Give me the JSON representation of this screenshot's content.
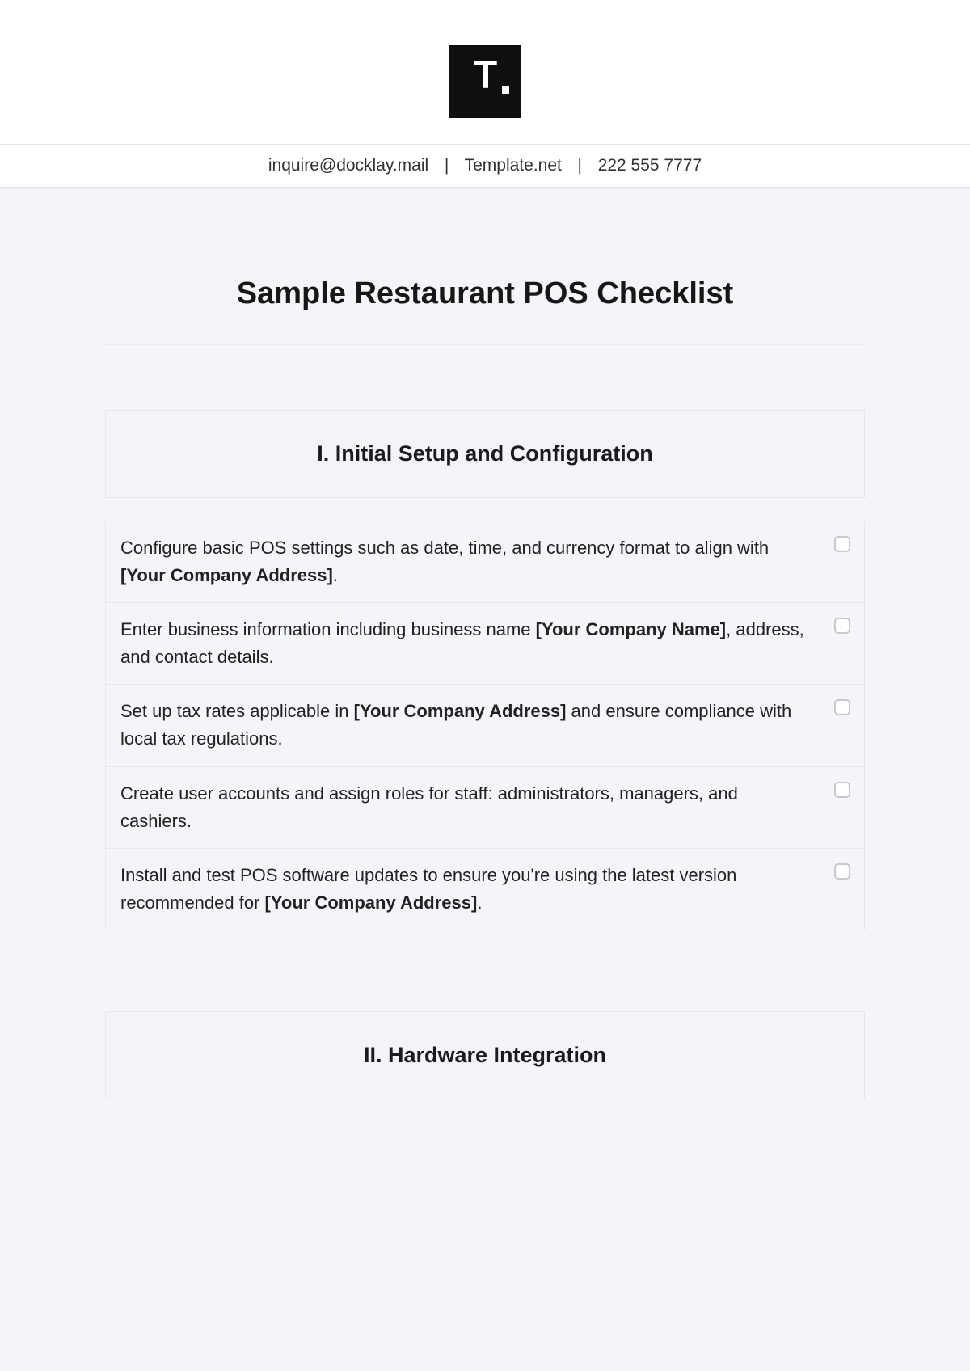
{
  "header": {
    "logo_text": "T",
    "contact": {
      "email": "inquire@docklay.mail",
      "site": "Template.net",
      "phone": "222 555 7777"
    }
  },
  "title": "Sample Restaurant POS Checklist",
  "sections": [
    {
      "heading": "I. Initial Setup and Configuration",
      "items": [
        {
          "pre": "Configure basic POS settings such as date, time, and currency format to align with ",
          "bold": "[Your Company Address]",
          "post": "."
        },
        {
          "pre": "Enter business information including business name ",
          "bold": "[Your Company Name]",
          "post": ", address, and contact details."
        },
        {
          "pre": "Set up tax rates applicable in ",
          "bold": "[Your Company Address]",
          "post": " and ensure compliance with local tax regulations."
        },
        {
          "pre": "Create user accounts and assign roles for staff: administrators, managers, and cashiers.",
          "bold": "",
          "post": ""
        },
        {
          "pre": "Install and test POS software updates to ensure you're using the latest version recommended for ",
          "bold": "[Your Company Address]",
          "post": "."
        }
      ]
    },
    {
      "heading": "II. Hardware Integration",
      "items": []
    }
  ]
}
